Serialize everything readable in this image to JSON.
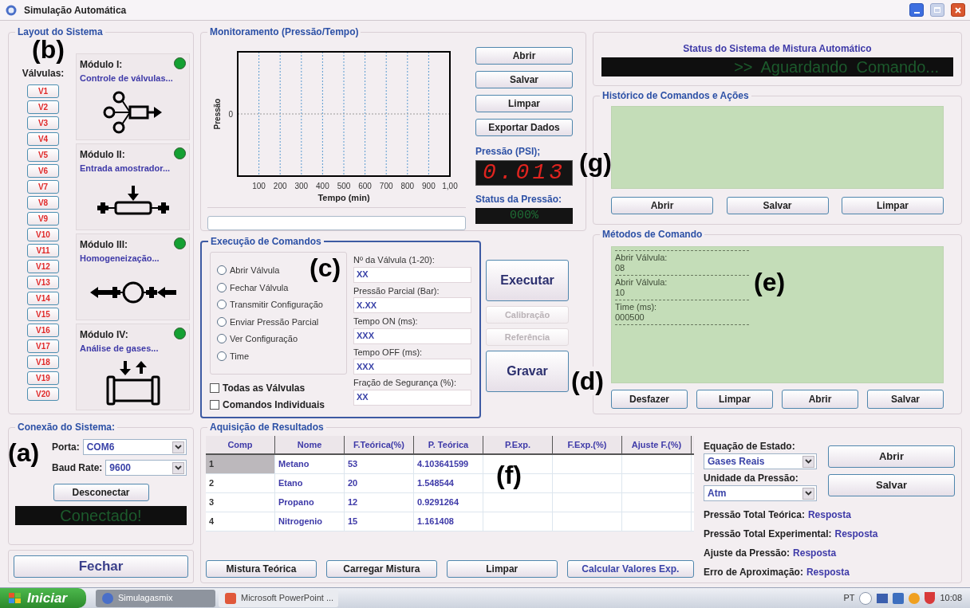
{
  "window": {
    "title": "Simulação Automática"
  },
  "annotations": [
    "(b)",
    "(g)",
    "(c)",
    "(e)",
    "(d)",
    "(a)",
    "(f)"
  ],
  "layout": {
    "title": "Layout do Sistema",
    "valves_label": "Válvulas:",
    "valves": [
      "V1",
      "V2",
      "V3",
      "V4",
      "V5",
      "V6",
      "V7",
      "V8",
      "V9",
      "V10",
      "V11",
      "V12",
      "V13",
      "V14",
      "V15",
      "V16",
      "V17",
      "V18",
      "V19",
      "V20"
    ],
    "modules": [
      {
        "title": "Módulo I:",
        "subtitle": "Controle de válvulas...",
        "on": true,
        "kind": "valves"
      },
      {
        "title": "Módulo II:",
        "subtitle": "Entrada amostrador...",
        "on": true,
        "kind": "sampler"
      },
      {
        "title": "Módulo III:",
        "subtitle": "Homogeneização...",
        "on": true,
        "kind": "mixer"
      },
      {
        "title": "Módulo IV:",
        "subtitle": "Análise de gases...",
        "on": true,
        "kind": "analyzer"
      }
    ]
  },
  "monitoring": {
    "title": "Monitoramento (Pressão/Tempo)",
    "plot": {
      "x_label": "Tempo (min)",
      "y_label": "Pressão",
      "x_tick_labels": [
        "100",
        "200",
        "300",
        "400",
        "500",
        "600",
        "700",
        "800",
        "900",
        "1,00"
      ],
      "y_tick_label": "0"
    },
    "progress": {
      "level": 0
    },
    "buttons": [
      "Abrir",
      "Salvar",
      "Limpar",
      "Exportar Dados"
    ],
    "pressure_label": "Pressão (PSI);",
    "pressure_value": "0.013",
    "status_label": "Status da Pressão:",
    "status_value": "000%"
  },
  "execution": {
    "title": "Execução de Comandos",
    "options": [
      {
        "label": "Abrir Válvula",
        "selected": false
      },
      {
        "label": "Fechar Válvula",
        "selected": false
      },
      {
        "label": "Transmitir Configuração",
        "selected": false
      },
      {
        "label": "Enviar Pressão Parcial",
        "selected": false
      },
      {
        "label": "Ver Configuração",
        "selected": false
      },
      {
        "label": "Time",
        "selected": false
      }
    ],
    "checkboxes": [
      {
        "label": "Todas as Válvulas",
        "checked": false
      },
      {
        "label": "Comandos Individuais",
        "checked": false
      }
    ],
    "fields": [
      {
        "label": "Nº da Válvula (1-20):",
        "value": "XX"
      },
      {
        "label": "Pressão Parcial (Bar):",
        "value": "X.XX"
      },
      {
        "label": "Tempo ON (ms):",
        "value": "XXX"
      },
      {
        "label": "Tempo OFF (ms):",
        "value": "XXX"
      },
      {
        "label": "Fração de Segurança (%):",
        "value": "XX"
      }
    ],
    "actions": [
      {
        "label": "Executar",
        "kind": "large",
        "disabled": false
      },
      {
        "label": "Calibração",
        "kind": "small",
        "disabled": true
      },
      {
        "label": "Referência",
        "kind": "small",
        "disabled": true
      },
      {
        "label": "Gravar",
        "kind": "large",
        "disabled": false
      }
    ]
  },
  "status": {
    "title": "Status do Sistema de Mistura Automático",
    "message": ">>  Aguardando  Comando..."
  },
  "history": {
    "title": "Histórico de Comandos e Ações",
    "buttons": [
      "Abrir",
      "Salvar",
      "Limpar"
    ]
  },
  "methods": {
    "title": "Métodos de Comando",
    "entries": [
      {
        "label": "Abrir Válvula:",
        "value": "08"
      },
      {
        "label": "Abrir Válvula:",
        "value": "10"
      },
      {
        "label": "Time (ms):",
        "value": "000500"
      }
    ],
    "buttons": [
      "Desfazer",
      "Limpar",
      "Abrir",
      "Salvar"
    ]
  },
  "connection": {
    "title": "Conexão do Sistema:",
    "fields": [
      {
        "label": "Porta:",
        "value": "COM6"
      },
      {
        "label": "Baud Rate:",
        "value": "9600"
      }
    ],
    "button": "Desconectar",
    "status": "Conectado!",
    "close_button": "Fechar"
  },
  "results": {
    "title": "Aquisição de Resultados",
    "columns": [
      "Comp",
      "Nome",
      "F.Teórica(%)",
      "P. Teórica",
      "P.Exp.",
      "F.Exp.(%)",
      "Ajuste F.(%)"
    ],
    "rows": [
      {
        "selected": true,
        "cells": [
          "1",
          "Metano",
          "53",
          "4.103641599"
        ]
      },
      {
        "selected": false,
        "cells": [
          "2",
          "Etano",
          "20",
          "1.548544"
        ]
      },
      {
        "selected": false,
        "cells": [
          "3",
          "Propano",
          "12",
          "0.9291264"
        ]
      },
      {
        "selected": false,
        "cells": [
          "4",
          "Nitrogenio",
          "15",
          "1.161408"
        ]
      }
    ],
    "buttons": [
      "Mistura Teórica",
      "Carregar Mistura",
      "Limpar",
      "Calcular Valores Exp."
    ],
    "selects": [
      {
        "label": "Equação de Estado:",
        "value": "Gases Reais"
      },
      {
        "label": "Unidade da Pressão:",
        "value": "Atm"
      }
    ],
    "side_buttons": [
      "Abrir",
      "Salvar"
    ],
    "outputs": [
      {
        "label": "Pressão Total Teórica:",
        "value": "Resposta"
      },
      {
        "label": "Pressão Total Experimental:",
        "value": "Resposta"
      },
      {
        "label": "Ajuste da Pressão:",
        "value": "Resposta"
      },
      {
        "label": "Erro de Aproximação:",
        "value": "Resposta"
      }
    ]
  },
  "taskbar": {
    "start": "Iniciar",
    "tasks": [
      {
        "label": "Simulagasmix",
        "selected": true
      },
      {
        "label": "Microsoft PowerPoint ...",
        "selected": false
      }
    ],
    "language": "PT",
    "clock": "10:08"
  }
}
